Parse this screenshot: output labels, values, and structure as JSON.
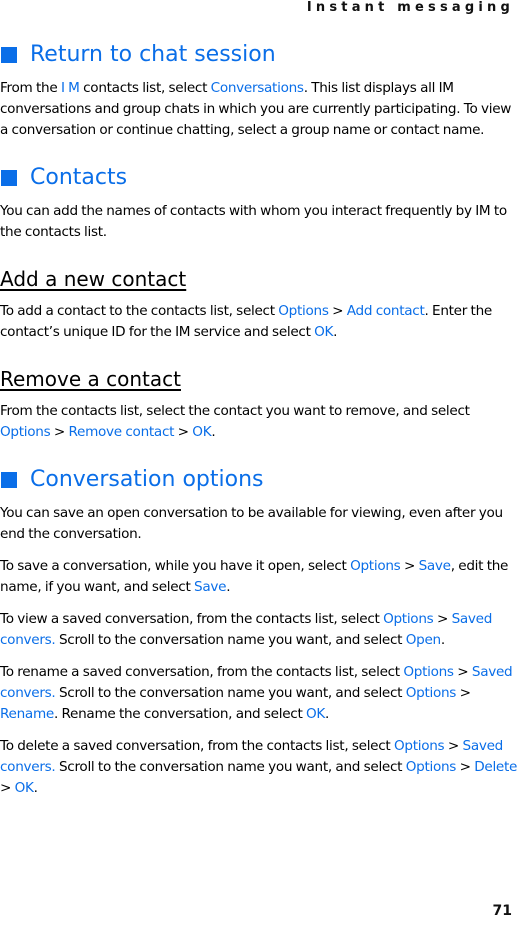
{
  "header": {
    "running_title": "Instant messaging"
  },
  "footer": {
    "page_number": "71"
  },
  "colors": {
    "accent": "#0a6ee8",
    "text": "#000000"
  },
  "sections": {
    "return_chat": {
      "title": "Return to chat session",
      "p1": {
        "t1": "From the ",
        "k1": "I M",
        "t2": " contacts list, select ",
        "k2": "Conversations",
        "t3": ". This list displays all IM conversations and group chats in which you are currently participating. To view a conversation or continue chatting, select a group name or contact name."
      }
    },
    "contacts": {
      "title": "Contacts",
      "p1": "You can add the names of contacts with whom you interact frequently by IM to the contacts list.",
      "add": {
        "title": "Add a new contact",
        "t1": "To add a contact to the contacts list, select ",
        "k1": "Options",
        "t2": " > ",
        "k2": "Add contact",
        "t3": ". Enter the contact’s unique ID for the IM service and select ",
        "k3": "OK",
        "t4": "."
      },
      "remove": {
        "title": "Remove a contact",
        "t1": "From the contacts list, select the contact you want to remove, and select ",
        "k1": "Options",
        "t2": " > ",
        "k2": "Remove contact",
        "t3": " > ",
        "k3": "OK",
        "t4": "."
      }
    },
    "conv_options": {
      "title": "Conversation options",
      "p1": "You can save an open conversation to be available for viewing, even after you end the conversation.",
      "save": {
        "t1": "To save a conversation, while you have it open, select ",
        "k1": "Options",
        "t2": " > ",
        "k2": "Save",
        "t3": ", edit the name, if you want, and select ",
        "k3": "Save",
        "t4": "."
      },
      "view": {
        "t1": "To view a saved conversation, from the contacts list, select ",
        "k1": "Options",
        "t2": " > ",
        "k2": "Saved convers.",
        "t3": " Scroll to the conversation name you want, and select ",
        "k3": "Open",
        "t4": "."
      },
      "rename": {
        "t1": "To rename a saved conversation, from the contacts list, select ",
        "k1": "Options",
        "t2": " > ",
        "k2": "Saved convers.",
        "t3": " Scroll to the conversation name you want, and select ",
        "k3": "Options",
        "t4": " > ",
        "k4": "Rename",
        "t5": ". Rename the conversation, and select ",
        "k5": "OK",
        "t6": "."
      },
      "delete": {
        "t1": "To delete a saved conversation, from the contacts list, select ",
        "k1": "Options",
        "t2": " > ",
        "k2": "Saved convers.",
        "t3": " Scroll to the conversation name you want, and select ",
        "k3": "Options",
        "t4": " > ",
        "k4": "Delete",
        "t5": " > ",
        "k5": "OK",
        "t6": "."
      }
    }
  }
}
